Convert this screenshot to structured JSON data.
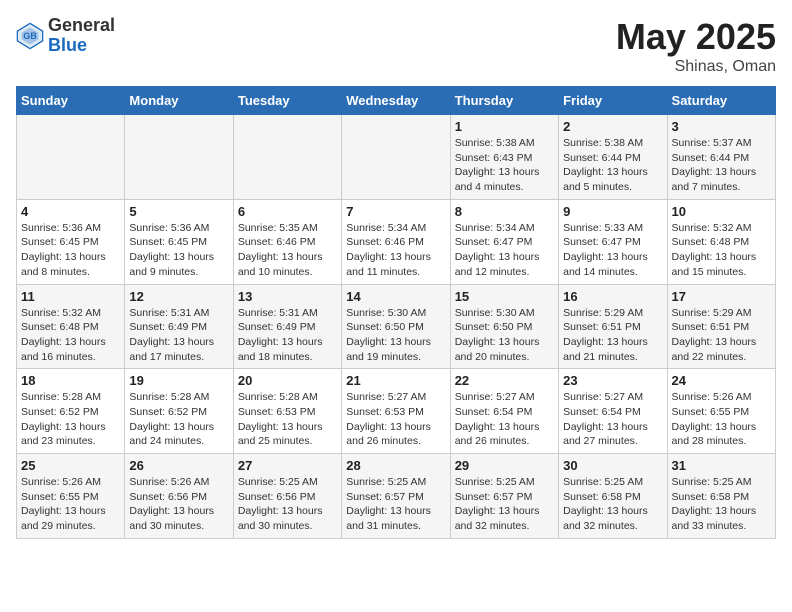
{
  "header": {
    "logo_general": "General",
    "logo_blue": "Blue",
    "month_year": "May 2025",
    "location": "Shinas, Oman"
  },
  "weekdays": [
    "Sunday",
    "Monday",
    "Tuesday",
    "Wednesday",
    "Thursday",
    "Friday",
    "Saturday"
  ],
  "weeks": [
    [
      {
        "day": "",
        "info": ""
      },
      {
        "day": "",
        "info": ""
      },
      {
        "day": "",
        "info": ""
      },
      {
        "day": "",
        "info": ""
      },
      {
        "day": "1",
        "info": "Sunrise: 5:38 AM\nSunset: 6:43 PM\nDaylight: 13 hours and 4 minutes."
      },
      {
        "day": "2",
        "info": "Sunrise: 5:38 AM\nSunset: 6:44 PM\nDaylight: 13 hours and 5 minutes."
      },
      {
        "day": "3",
        "info": "Sunrise: 5:37 AM\nSunset: 6:44 PM\nDaylight: 13 hours and 7 minutes."
      }
    ],
    [
      {
        "day": "4",
        "info": "Sunrise: 5:36 AM\nSunset: 6:45 PM\nDaylight: 13 hours and 8 minutes."
      },
      {
        "day": "5",
        "info": "Sunrise: 5:36 AM\nSunset: 6:45 PM\nDaylight: 13 hours and 9 minutes."
      },
      {
        "day": "6",
        "info": "Sunrise: 5:35 AM\nSunset: 6:46 PM\nDaylight: 13 hours and 10 minutes."
      },
      {
        "day": "7",
        "info": "Sunrise: 5:34 AM\nSunset: 6:46 PM\nDaylight: 13 hours and 11 minutes."
      },
      {
        "day": "8",
        "info": "Sunrise: 5:34 AM\nSunset: 6:47 PM\nDaylight: 13 hours and 12 minutes."
      },
      {
        "day": "9",
        "info": "Sunrise: 5:33 AM\nSunset: 6:47 PM\nDaylight: 13 hours and 14 minutes."
      },
      {
        "day": "10",
        "info": "Sunrise: 5:32 AM\nSunset: 6:48 PM\nDaylight: 13 hours and 15 minutes."
      }
    ],
    [
      {
        "day": "11",
        "info": "Sunrise: 5:32 AM\nSunset: 6:48 PM\nDaylight: 13 hours and 16 minutes."
      },
      {
        "day": "12",
        "info": "Sunrise: 5:31 AM\nSunset: 6:49 PM\nDaylight: 13 hours and 17 minutes."
      },
      {
        "day": "13",
        "info": "Sunrise: 5:31 AM\nSunset: 6:49 PM\nDaylight: 13 hours and 18 minutes."
      },
      {
        "day": "14",
        "info": "Sunrise: 5:30 AM\nSunset: 6:50 PM\nDaylight: 13 hours and 19 minutes."
      },
      {
        "day": "15",
        "info": "Sunrise: 5:30 AM\nSunset: 6:50 PM\nDaylight: 13 hours and 20 minutes."
      },
      {
        "day": "16",
        "info": "Sunrise: 5:29 AM\nSunset: 6:51 PM\nDaylight: 13 hours and 21 minutes."
      },
      {
        "day": "17",
        "info": "Sunrise: 5:29 AM\nSunset: 6:51 PM\nDaylight: 13 hours and 22 minutes."
      }
    ],
    [
      {
        "day": "18",
        "info": "Sunrise: 5:28 AM\nSunset: 6:52 PM\nDaylight: 13 hours and 23 minutes."
      },
      {
        "day": "19",
        "info": "Sunrise: 5:28 AM\nSunset: 6:52 PM\nDaylight: 13 hours and 24 minutes."
      },
      {
        "day": "20",
        "info": "Sunrise: 5:28 AM\nSunset: 6:53 PM\nDaylight: 13 hours and 25 minutes."
      },
      {
        "day": "21",
        "info": "Sunrise: 5:27 AM\nSunset: 6:53 PM\nDaylight: 13 hours and 26 minutes."
      },
      {
        "day": "22",
        "info": "Sunrise: 5:27 AM\nSunset: 6:54 PM\nDaylight: 13 hours and 26 minutes."
      },
      {
        "day": "23",
        "info": "Sunrise: 5:27 AM\nSunset: 6:54 PM\nDaylight: 13 hours and 27 minutes."
      },
      {
        "day": "24",
        "info": "Sunrise: 5:26 AM\nSunset: 6:55 PM\nDaylight: 13 hours and 28 minutes."
      }
    ],
    [
      {
        "day": "25",
        "info": "Sunrise: 5:26 AM\nSunset: 6:55 PM\nDaylight: 13 hours and 29 minutes."
      },
      {
        "day": "26",
        "info": "Sunrise: 5:26 AM\nSunset: 6:56 PM\nDaylight: 13 hours and 30 minutes."
      },
      {
        "day": "27",
        "info": "Sunrise: 5:25 AM\nSunset: 6:56 PM\nDaylight: 13 hours and 30 minutes."
      },
      {
        "day": "28",
        "info": "Sunrise: 5:25 AM\nSunset: 6:57 PM\nDaylight: 13 hours and 31 minutes."
      },
      {
        "day": "29",
        "info": "Sunrise: 5:25 AM\nSunset: 6:57 PM\nDaylight: 13 hours and 32 minutes."
      },
      {
        "day": "30",
        "info": "Sunrise: 5:25 AM\nSunset: 6:58 PM\nDaylight: 13 hours and 32 minutes."
      },
      {
        "day": "31",
        "info": "Sunrise: 5:25 AM\nSunset: 6:58 PM\nDaylight: 13 hours and 33 minutes."
      }
    ]
  ]
}
